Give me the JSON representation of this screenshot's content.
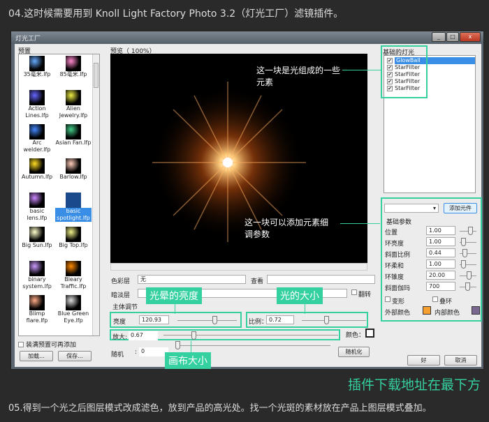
{
  "top_text": "04.这时候需要用到 Knoll Light Factory Photo 3.2（灯光工厂）滤镜插件。",
  "bottom_heading": "插件下载地址在最下方",
  "bottom_text": "05.得到一个光之后图层模式改成滤色，放到产品的高光处。找一个光斑的素材放在产品上图层模式叠加。",
  "window": {
    "title": "灯光工厂",
    "controls": [
      "_",
      "□",
      "x"
    ]
  },
  "presets": {
    "label": "预置",
    "items": [
      "35毫米.lfp",
      "85毫米.lfp",
      "Action Lines.lfp",
      "Alien Jewelry.lfp",
      "Arc welder.lfp",
      "Asian Fan.lfp",
      "Autumn.lfp",
      "Barlow.lfp",
      "basic lens.lfp",
      "basic spotlight.lfp",
      "Big Sun.lfp",
      "Big Top.lfp",
      "binary system.lfp",
      "Bleary Traffic.lfp",
      "Blimp flare.lfp",
      "Blue Green Eye.lfp"
    ],
    "selected": "basic spotlight.lfp",
    "checkbox_label": "装满预置可再添加",
    "load": "加载...",
    "save": "保存..."
  },
  "preview": {
    "label": "预览（ 100%）"
  },
  "controls": {
    "color_layer_label": "色彩层",
    "color_layer_value": "无",
    "view_label": "查看",
    "view_value": "",
    "dark_layer_label": "暗淡层",
    "flip_label": "翻转",
    "main_adjust": "主体调节",
    "brightness_label": "亮度",
    "brightness": "120.93",
    "brightness_level": 0.65,
    "scale_label": "比例：",
    "scale": "0.72",
    "scale_level": 0.35,
    "zoom_label": "放大:",
    "zoom": "0.67",
    "zoom_level": 0.4,
    "color_label": "颜色：",
    "random_label": "随机",
    "random": "0",
    "randomize": "随机化"
  },
  "lights": {
    "label": "基础的灯光",
    "items": [
      "GlowBall",
      "StarFilter",
      "StarFilter",
      "StarFilter",
      "StarFilter"
    ],
    "selected": "GlowBall"
  },
  "element": {
    "dropdown": "",
    "add_button": "添加元件",
    "params_label": "基础参数",
    "params": [
      {
        "label": "位置",
        "value": "1.00"
      },
      {
        "label": "环亮度",
        "value": "1.00"
      },
      {
        "label": "斜面比例",
        "value": "0.44"
      },
      {
        "label": "环柔和",
        "value": "1.00"
      },
      {
        "label": "环锥度",
        "value": "20.00"
      },
      {
        "label": "斜面伽玛",
        "value": "700"
      }
    ],
    "deform": "变形",
    "stack": "叠环",
    "outer_color_label": "外部颜色",
    "outer_color": "#f5a030",
    "inner_color_label": "内部颜色",
    "inner_color": "#7a6890"
  },
  "ok": "好",
  "cancel": "取消",
  "annotations": {
    "elements_note": "这一块是光组成的一些元素",
    "add_note": "这一块可以添加元素细调参数",
    "halo_brightness": "光晕的亮度",
    "light_size": "光的大小",
    "canvas_size": "画布大小"
  },
  "accent": "#35d0a0"
}
